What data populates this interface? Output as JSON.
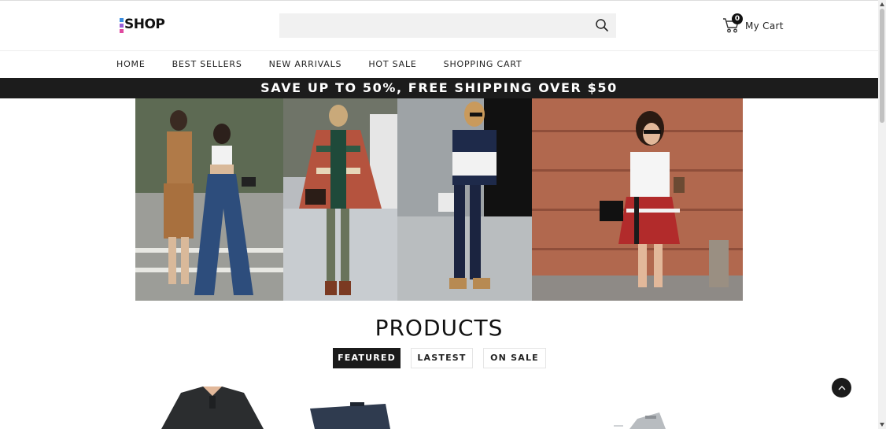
{
  "brand": {
    "logo_text": "SHOP"
  },
  "search": {
    "value": "",
    "placeholder": "",
    "icon": "search-icon"
  },
  "cart": {
    "count": "0",
    "label": "My Cart",
    "icon": "cart-icon"
  },
  "nav": {
    "items": [
      {
        "label": "HOME"
      },
      {
        "label": "BEST SELLERS"
      },
      {
        "label": "NEW ARRIVALS"
      },
      {
        "label": "HOT SALE"
      },
      {
        "label": "SHOPPING CART"
      }
    ]
  },
  "promo": {
    "text": "SAVE UP TO 50%, FREE SHIPPING OVER $50"
  },
  "products": {
    "title": "PRODUCTS",
    "tabs": [
      {
        "label": "FEATURED",
        "active": true
      },
      {
        "label": "LASTEST",
        "active": false
      },
      {
        "label": "ON SALE",
        "active": false
      }
    ]
  },
  "colors": {
    "dark": "#1c1c1c",
    "search_bg": "#f1f1f1",
    "brand_blue": "#3b8de0",
    "brand_purple": "#9a5fd8",
    "brand_pink": "#e04ba0"
  }
}
